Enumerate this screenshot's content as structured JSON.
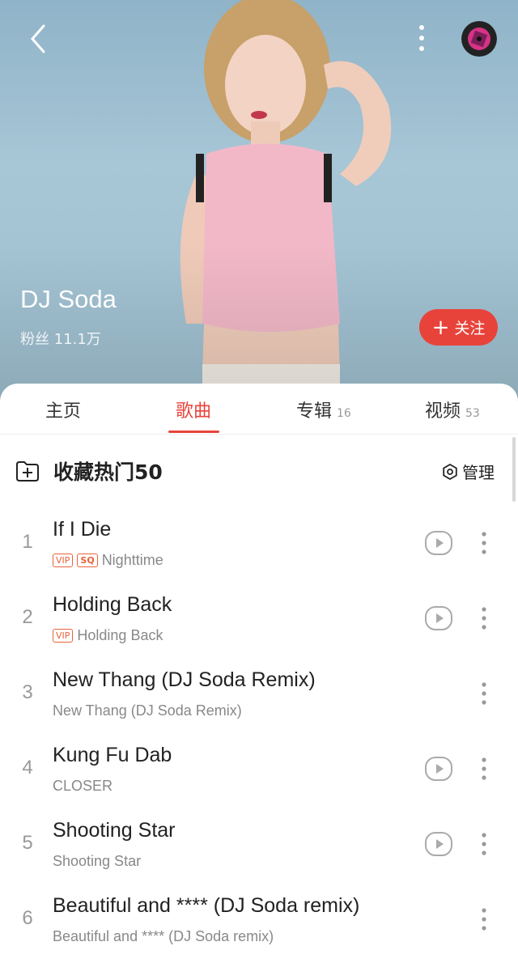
{
  "artist": {
    "name": "DJ Soda",
    "fans": "粉丝 11.1万",
    "follow_label": "关注",
    "follow_icon": "plus-icon"
  },
  "header": {
    "back_icon": "chevron-left-icon",
    "more_icon": "more-vertical-icon",
    "disc_icon": "vinyl-disc-icon"
  },
  "tabs": [
    {
      "label": "主页",
      "count": ""
    },
    {
      "label": "歌曲",
      "count": ""
    },
    {
      "label": "专辑",
      "count": "16"
    },
    {
      "label": "视频",
      "count": "53"
    }
  ],
  "active_tab": "歌曲",
  "collect": {
    "label": "收藏热门50",
    "icon": "add-folder-icon",
    "manage_label": "管理",
    "manage_icon": "gear-icon"
  },
  "songs": [
    {
      "index": "1",
      "title": "If I Die",
      "album": "Nighttime",
      "badges": [
        "VIP",
        "SQ"
      ],
      "has_play": true
    },
    {
      "index": "2",
      "title": "Holding Back",
      "album": "Holding Back",
      "badges": [
        "VIP"
      ],
      "has_play": true
    },
    {
      "index": "3",
      "title": "New Thang (DJ Soda Remix)",
      "album": "New Thang (DJ Soda Remix)",
      "badges": [],
      "has_play": false
    },
    {
      "index": "4",
      "title": "Kung Fu Dab",
      "album": "CLOSER",
      "badges": [],
      "has_play": true
    },
    {
      "index": "5",
      "title": "Shooting Star",
      "album": "Shooting Star",
      "badges": [],
      "has_play": true
    },
    {
      "index": "6",
      "title": "Beautiful and **** (DJ Soda remix)",
      "album": "Beautiful and **** (DJ Soda remix)",
      "badges": [],
      "has_play": false
    }
  ],
  "colors": {
    "accent": "#e8433a",
    "hero_bg": "#9fc0d0"
  }
}
